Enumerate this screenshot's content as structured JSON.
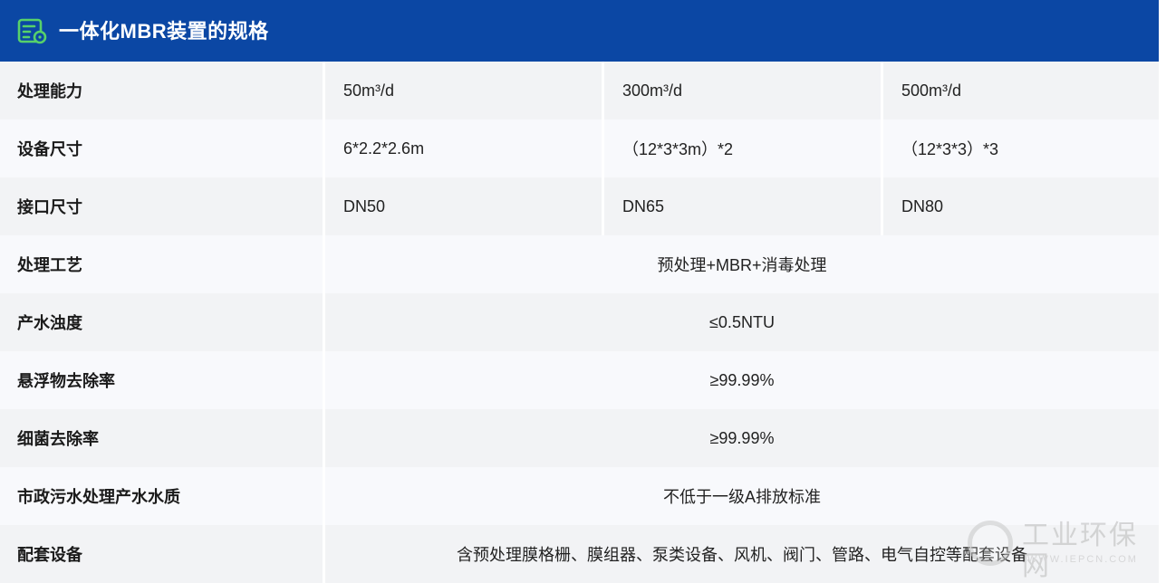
{
  "header": {
    "title": "一体化MBR装置的规格",
    "icon": "spec-sheet-icon",
    "color": "#0b47a4"
  },
  "rows": [
    {
      "label": "处理能力",
      "values": [
        "50m³/d",
        "300m³/d",
        "500m³/d"
      ]
    },
    {
      "label": "设备尺寸",
      "values": [
        "6*2.2*2.6m",
        "（12*3*3m）*2",
        "（12*3*3）*3"
      ]
    },
    {
      "label": "接口尺寸",
      "values": [
        "DN50",
        "DN65",
        "DN80"
      ]
    },
    {
      "label": "处理工艺",
      "value": "预处理+MBR+消毒处理"
    },
    {
      "label": "产水浊度",
      "value": "≤0.5NTU"
    },
    {
      "label": "悬浮物去除率",
      "value": "≥99.99%"
    },
    {
      "label": "细菌去除率",
      "value": "≥99.99%"
    },
    {
      "label": "市政污水处理产水水质",
      "value": "不低于一级A排放标准"
    },
    {
      "label": "配套设备",
      "value": "含预处理膜格栅、膜组器、泵类设备、风机、阀门、管路、电气自控等配套设备"
    }
  ],
  "watermark": {
    "text": "工业环保网",
    "url": "WWW.IEPCN.COM"
  }
}
